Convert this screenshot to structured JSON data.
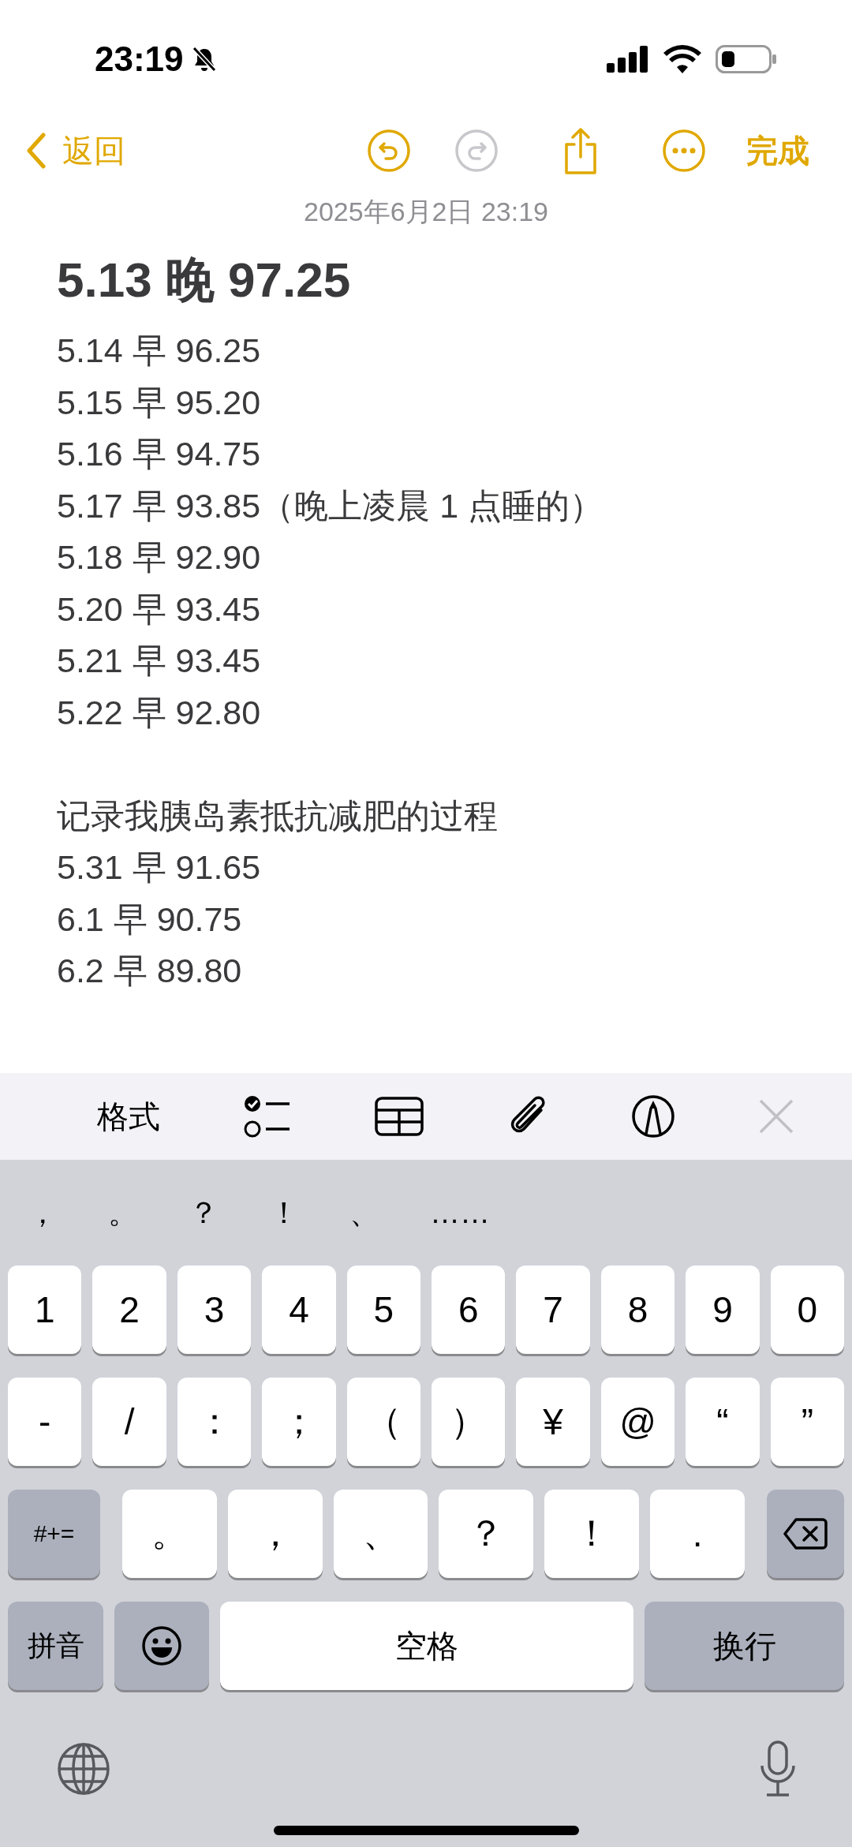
{
  "status_bar": {
    "time": "23:19"
  },
  "nav": [
    {
      "kind": "back",
      "label": "返回",
      "disabled": false
    },
    {
      "kind": "undo",
      "disabled": false
    },
    {
      "kind": "redo",
      "disabled": true
    },
    {
      "kind": "share",
      "disabled": false
    },
    {
      "kind": "more",
      "disabled": false
    },
    {
      "kind": "done",
      "label": "完成",
      "disabled": false
    }
  ],
  "date": "2025年6月2日 23:19",
  "note": {
    "title": "5.13 晚 97.25",
    "blocks": [
      [
        "5.14 早 96.25",
        "5.15 早 95.20",
        "5.16 早 94.75",
        "5.17 早 93.85（晚上凌晨 1 点睡的）",
        "5.18 早 92.90",
        "5.20 早 93.45",
        "5.21 早 93.45",
        "5.22 早 92.80"
      ],
      [
        "记录我胰岛素抵抗减肥的过程",
        "5.31 早 91.65",
        "6.1 早 90.75",
        "6.2 早 89.80"
      ]
    ]
  },
  "format_toolbar": {
    "format_label": "格式"
  },
  "keyboard": {
    "candidates": [
      "，",
      "。",
      "？",
      "！",
      "、",
      "……"
    ],
    "rows": [
      {
        "keys": [
          {
            "kind": "char",
            "label": "1"
          },
          {
            "kind": "char",
            "label": "2"
          },
          {
            "kind": "char",
            "label": "3"
          },
          {
            "kind": "char",
            "label": "4"
          },
          {
            "kind": "char",
            "label": "5"
          },
          {
            "kind": "char",
            "label": "6"
          },
          {
            "kind": "char",
            "label": "7"
          },
          {
            "kind": "char",
            "label": "8"
          },
          {
            "kind": "char",
            "label": "9"
          },
          {
            "kind": "char",
            "label": "0"
          }
        ]
      },
      {
        "keys": [
          {
            "kind": "char",
            "label": "-"
          },
          {
            "kind": "char",
            "label": "/"
          },
          {
            "kind": "char",
            "label": "："
          },
          {
            "kind": "char",
            "label": "；"
          },
          {
            "kind": "char",
            "label": "（"
          },
          {
            "kind": "char",
            "label": "）"
          },
          {
            "kind": "char",
            "label": "¥"
          },
          {
            "kind": "char",
            "label": "@"
          },
          {
            "kind": "char",
            "label": "“"
          },
          {
            "kind": "char",
            "label": "”"
          }
        ]
      },
      {
        "keys": [
          {
            "kind": "symbols",
            "label": "#+="
          },
          {
            "kind": "char",
            "label": "。"
          },
          {
            "kind": "char",
            "label": "，"
          },
          {
            "kind": "char",
            "label": "、"
          },
          {
            "kind": "char",
            "label": "？"
          },
          {
            "kind": "char",
            "label": "！"
          },
          {
            "kind": "char",
            "label": "."
          },
          {
            "kind": "delete"
          }
        ]
      },
      {
        "keys": [
          {
            "kind": "pinyin",
            "label": "拼音"
          },
          {
            "kind": "emoji"
          },
          {
            "kind": "space",
            "label": "空格"
          },
          {
            "kind": "return",
            "label": "换行"
          }
        ]
      }
    ]
  }
}
